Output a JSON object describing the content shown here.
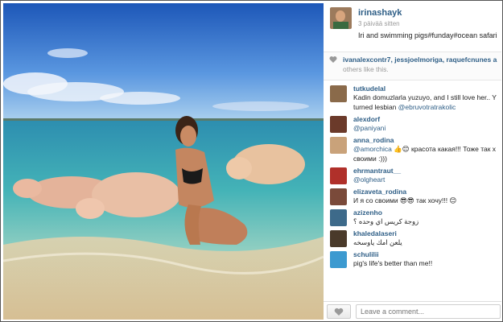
{
  "post": {
    "username": "irinashayk",
    "time": "3 päivää sitten",
    "caption": "Iri and swimming pigs#funday#ocean safari",
    "photo_icon": "beach-photo-with-pigs"
  },
  "likes": {
    "icon": "heart-icon",
    "likers": "ivanalexcontr7, jessjoelmoriga, raquefcnunes a",
    "tail": "others like this."
  },
  "comments": [
    {
      "user": "tutkudelal",
      "text": "Kadin domuzlarla yuzuyo, and I still love her.. Y turned lesbian ",
      "mention": "@ebruvotratrakolic",
      "avatar_color": "#8a6a4a"
    },
    {
      "user": "alexdorf",
      "text": "",
      "mention": "@paniyani",
      "avatar_color": "#6b3a2a"
    },
    {
      "user": "anna_rodina",
      "text": " 👍😊 красота какая!!! Тоже так х своими :)))",
      "mention": "@amorchica",
      "avatar_color": "#c9a27a"
    },
    {
      "user": "ehrmantraut__",
      "text": "",
      "mention": "@olgheart",
      "avatar_color": "#b0302a"
    },
    {
      "user": "elizaveta_rodina",
      "text": "И я со своими 😎😎 так хочу!!! 😊",
      "mention": "",
      "avatar_color": "#7a4a3a"
    },
    {
      "user": "azizenho",
      "text": "زوجة كريس اي وحده ؟",
      "mention": "",
      "avatar_color": "#3d6a8a"
    },
    {
      "user": "khaledalaseri",
      "text": "يلعن امك ياوسخه",
      "mention": "",
      "avatar_color": "#4a3a2a"
    },
    {
      "user": "schulilii",
      "text": "pig's life's better than me!!",
      "mention": "",
      "avatar_color": "#3c9ad0"
    }
  ],
  "composer": {
    "placeholder": "Leave a comment...",
    "like_icon": "heart-icon"
  }
}
